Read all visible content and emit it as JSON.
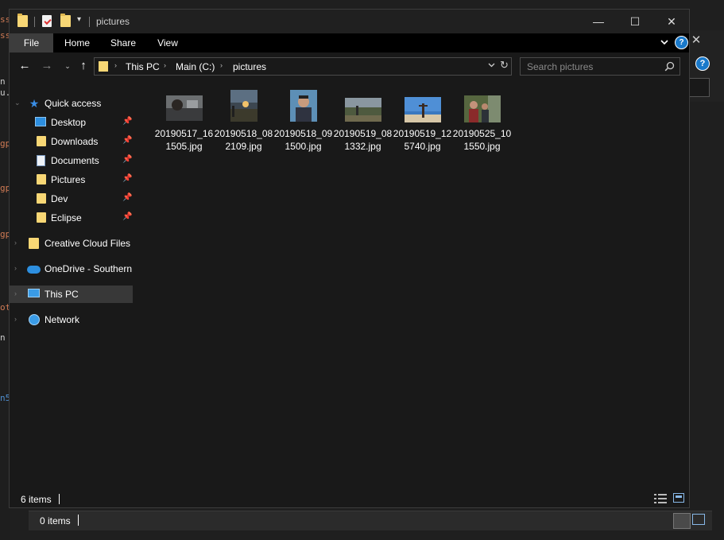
{
  "window": {
    "title": "pictures",
    "controls": {
      "minimize": "—",
      "maximize": "☐",
      "close": "✕"
    }
  },
  "ribbon": {
    "tabs": [
      "File",
      "Home",
      "Share",
      "View"
    ],
    "expand_icon": "chevron-down-icon",
    "help_label": "?"
  },
  "navigation": {
    "back_icon": "←",
    "forward_icon": "→",
    "recent_icon": "⌄",
    "up_icon": "↑"
  },
  "address": {
    "breadcrumbs": [
      "This PC",
      "Main (C:)",
      "pictures"
    ],
    "separator": "›"
  },
  "search": {
    "placeholder": "Search pictures",
    "value": ""
  },
  "nav_pane": {
    "items": [
      {
        "label": "Quick access",
        "icon": "star-icon",
        "pinned": false
      },
      {
        "label": "Desktop",
        "icon": "desktop-icon",
        "pinned": true
      },
      {
        "label": "Downloads",
        "icon": "downloads-icon",
        "pinned": true
      },
      {
        "label": "Documents",
        "icon": "documents-icon",
        "pinned": true
      },
      {
        "label": "Pictures",
        "icon": "pictures-icon",
        "pinned": true
      },
      {
        "label": "Dev",
        "icon": "folder-icon",
        "pinned": true
      },
      {
        "label": "Eclipse",
        "icon": "folder-icon",
        "pinned": true
      },
      {
        "label": "Creative Cloud Files",
        "icon": "creative-cloud-icon",
        "pinned": false
      },
      {
        "label": "OneDrive - Southern",
        "icon": "onedrive-icon",
        "pinned": false
      },
      {
        "label": "This PC",
        "icon": "this-pc-icon",
        "pinned": false,
        "selected": true
      },
      {
        "label": "Network",
        "icon": "network-icon",
        "pinned": false
      }
    ]
  },
  "files": [
    {
      "name": "20190517_161505.jpg"
    },
    {
      "name": "20190518_082109.jpg"
    },
    {
      "name": "20190518_091500.jpg"
    },
    {
      "name": "20190519_081332.jpg"
    },
    {
      "name": "20190519_125740.jpg"
    },
    {
      "name": "20190525_101550.jpg"
    }
  ],
  "status": {
    "item_count": "6 items"
  },
  "background_window": {
    "status": "0 items"
  },
  "colors": {
    "accent": "#1979ca",
    "folder": "#f8d775",
    "background": "#191919",
    "selected": "#383838"
  }
}
